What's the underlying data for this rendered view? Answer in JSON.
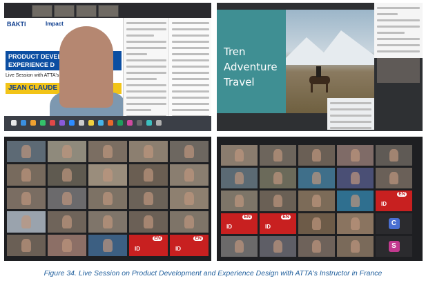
{
  "top_left": {
    "brand": "BAKTI",
    "brand2": "Impact",
    "slide_title": "PRODUCT DEVELOP\nEXPERIENCE D",
    "live_text": "Live Session with ATTA's Inst",
    "presenter_name": "JEAN CLAUDE"
  },
  "top_right": {
    "slide_title_line1": "Tren",
    "slide_title_line2": "Adventure",
    "slide_title_line3": "Travel"
  },
  "grid_left": {
    "tiles": [
      {
        "type": "video",
        "color": "#5d6a75"
      },
      {
        "type": "video",
        "color": "#8f8a7c"
      },
      {
        "type": "video",
        "color": "#7b6e62"
      },
      {
        "type": "video",
        "color": "#8c7f70"
      },
      {
        "type": "video",
        "color": "#6d6760"
      },
      {
        "type": "video",
        "color": "#776a5d"
      },
      {
        "type": "video",
        "color": "#5f5a50"
      },
      {
        "type": "video",
        "color": "#9a8d7c"
      },
      {
        "type": "video",
        "color": "#6a5e52"
      },
      {
        "type": "video",
        "color": "#8a7e70"
      },
      {
        "type": "video",
        "color": "#7a6d62"
      },
      {
        "type": "video",
        "color": "#6b6a6c"
      },
      {
        "type": "video",
        "color": "#7d7265"
      },
      {
        "type": "video",
        "color": "#6b6258"
      },
      {
        "type": "video",
        "color": "#8e8070"
      },
      {
        "type": "video",
        "color": "#9aa3ad"
      },
      {
        "type": "video",
        "color": "#6f645a"
      },
      {
        "type": "video",
        "color": "#7f756a"
      },
      {
        "type": "video",
        "color": "#6b6056"
      },
      {
        "type": "video",
        "color": "#7e7468"
      },
      {
        "type": "video",
        "color": "#6a5f55"
      },
      {
        "type": "video",
        "color": "#8c6f66"
      },
      {
        "type": "video",
        "color": "#3c5f82"
      },
      {
        "type": "zoom",
        "en": "EN",
        "id": "ID"
      },
      {
        "type": "zoom",
        "en": "EN",
        "id": "ID"
      }
    ]
  },
  "grid_right": {
    "tiles": [
      {
        "type": "video",
        "color": "#8a7c6e"
      },
      {
        "type": "video",
        "color": "#6d655c"
      },
      {
        "type": "video",
        "color": "#6a5f55"
      },
      {
        "type": "video",
        "color": "#7f6b67"
      },
      {
        "type": "video",
        "color": "#5f5a55"
      },
      {
        "type": "video",
        "color": "#5b6a74"
      },
      {
        "type": "video",
        "color": "#6b6a5a"
      },
      {
        "type": "video",
        "color": "#3f6f8a"
      },
      {
        "type": "video",
        "color": "#4a4f75"
      },
      {
        "type": "video",
        "color": "#6a6058"
      },
      {
        "type": "video",
        "color": "#7d7568"
      },
      {
        "type": "video",
        "color": "#6a6055"
      },
      {
        "type": "video",
        "color": "#7c6b58"
      },
      {
        "type": "video",
        "color": "#2f6f8f"
      },
      {
        "type": "zoom",
        "en": "EN",
        "id": "ID"
      },
      {
        "type": "zoom",
        "en": "EN",
        "id": "ID"
      },
      {
        "type": "zoom",
        "en": "EN",
        "id": "ID"
      },
      {
        "type": "video",
        "color": "#6d5b48"
      },
      {
        "type": "video",
        "color": "#8a7460"
      },
      {
        "type": "letter",
        "letter": "C",
        "bg": "#4a6fd1"
      },
      {
        "type": "video",
        "color": "#6b6a6a"
      },
      {
        "type": "video",
        "color": "#5e5e66"
      },
      {
        "type": "video",
        "color": "#6e625a"
      },
      {
        "type": "video",
        "color": "#7a6a5a"
      },
      {
        "type": "letter",
        "letter": "S",
        "bg": "#c23a8f"
      }
    ]
  },
  "caption": "Figure 34. Live Session on Product Development and Experience Design with ATTA's Instructor in France"
}
